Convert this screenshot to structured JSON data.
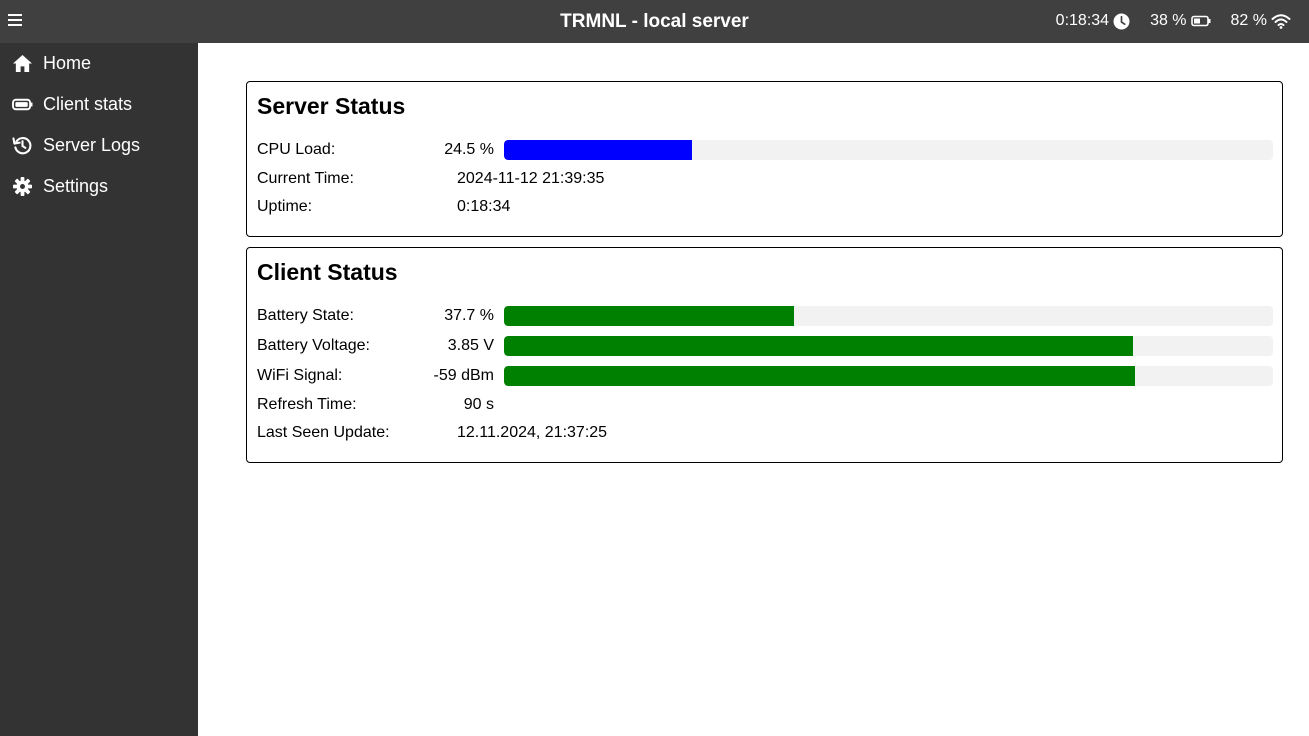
{
  "header": {
    "title": "TRMNL - local server",
    "uptime": "0:18:34",
    "battery": "38 %",
    "wifi": "82 %"
  },
  "sidebar": {
    "items": [
      {
        "label": "Home",
        "icon": "home-icon"
      },
      {
        "label": "Client stats",
        "icon": "battery-icon"
      },
      {
        "label": "Server Logs",
        "icon": "history-icon"
      },
      {
        "label": "Settings",
        "icon": "gear-icon"
      }
    ]
  },
  "server_status": {
    "title": "Server Status",
    "cpu_label": "CPU Load:",
    "cpu_value": "24.5 %",
    "cpu_fraction": 0.245,
    "time_label": "Current Time:",
    "time_value": "2024-11-12 21:39:35",
    "uptime_label": "Uptime:",
    "uptime_value": "0:18:34"
  },
  "client_status": {
    "title": "Client Status",
    "battery_label": "Battery State:",
    "battery_value": "37.7 %",
    "battery_fraction": 0.377,
    "voltage_label": "Battery Voltage:",
    "voltage_value": "3.85 V",
    "voltage_fraction": 0.818,
    "wifi_label": "WiFi Signal:",
    "wifi_value": "-59 dBm",
    "wifi_fraction": 0.82,
    "refresh_label": "Refresh Time:",
    "refresh_value": "90 s",
    "lastseen_label": "Last Seen Update:",
    "lastseen_value": "12.11.2024, 21:37:25"
  },
  "colors": {
    "topbar": "#404040",
    "sidebar": "#333333",
    "cpu_bar": "#0000ff",
    "client_bar": "#008000",
    "bar_track": "#f2f2f2"
  }
}
